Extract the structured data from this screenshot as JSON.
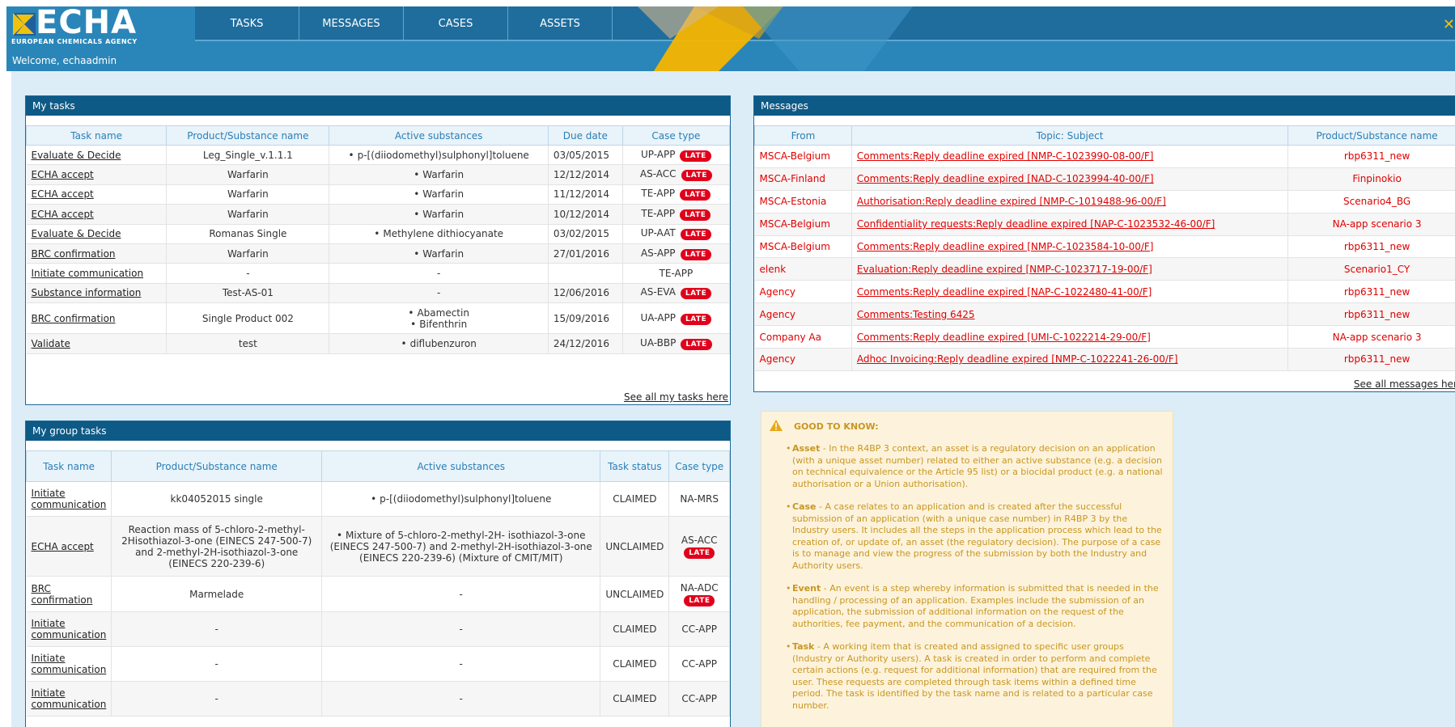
{
  "header": {
    "logo_text": "ECHA",
    "logo_sub": "EUROPEAN CHEMICALS AGENCY",
    "welcome": "Welcome, echaadmin",
    "nav": [
      "TASKS",
      "MESSAGES",
      "CASES",
      "ASSETS"
    ],
    "close_glyph": "✕"
  },
  "my_tasks": {
    "title": "My tasks",
    "columns": [
      "Task name",
      "Product/Substance name",
      "Active substances",
      "Due date",
      "Case type"
    ],
    "rows": [
      {
        "task": "Evaluate & Decide",
        "product": "Leg_Single_v.1.1.1",
        "active": [
          "p-[(diiodomethyl)sulphonyl]toluene"
        ],
        "due": "03/05/2015",
        "case": "UP-APP",
        "late": "LATE"
      },
      {
        "task": "ECHA accept",
        "product": "Warfarin",
        "active": [
          "Warfarin"
        ],
        "due": "12/12/2014",
        "case": "AS-ACC",
        "late": "LATE"
      },
      {
        "task": "ECHA accept",
        "product": "Warfarin",
        "active": [
          "Warfarin"
        ],
        "due": "11/12/2014",
        "case": "TE-APP",
        "late": "LATE"
      },
      {
        "task": "ECHA accept",
        "product": "Warfarin",
        "active": [
          "Warfarin"
        ],
        "due": "10/12/2014",
        "case": "TE-APP",
        "late": "LATE"
      },
      {
        "task": "Evaluate & Decide",
        "product": "Romanas Single",
        "active": [
          "Methylene dithiocyanate"
        ],
        "due": "03/02/2015",
        "case": "UP-AAT",
        "late": "LATE"
      },
      {
        "task": "BRC confirmation",
        "product": "Warfarin",
        "active": [
          "Warfarin"
        ],
        "due": "27/01/2016",
        "case": "AS-APP",
        "late": "LATE"
      },
      {
        "task": "Initiate communication",
        "product": "-",
        "active_text": "-",
        "due": "",
        "case": "TE-APP",
        "late": ""
      },
      {
        "task": "Substance information",
        "product": "Test-AS-01",
        "active_text": "-",
        "due": "12/06/2016",
        "case": "AS-EVA",
        "late": "LATE"
      },
      {
        "task": "BRC confirmation",
        "product": "Single Product 002",
        "active": [
          "Abamectin",
          "Bifenthrin"
        ],
        "due": "15/09/2016",
        "case": "UA-APP",
        "late": "LATE"
      },
      {
        "task": "Validate",
        "product": "test",
        "active": [
          "diflubenzuron"
        ],
        "due": "24/12/2016",
        "case": "UA-BBP",
        "late": "LATE"
      }
    ],
    "see_all": "See all my tasks here"
  },
  "group_tasks": {
    "title": "My group tasks",
    "columns": [
      "Task name",
      "Product/Substance name",
      "Active substances",
      "Task status",
      "Case type"
    ],
    "rows": [
      {
        "task": "Initiate communication",
        "product": "kk04052015 single",
        "active": "p-[(diiodomethyl)sulphonyl]toluene",
        "bullet": true,
        "status": "CLAIMED",
        "case": "NA-MRS",
        "late": ""
      },
      {
        "task": "ECHA accept",
        "product": "Reaction mass of 5-chloro-2-methyl-2Hisothiazol-3-one (EINECS 247-500-7) and 2-methyl-2H-isothiazol-3-one (EINECS 220-239-6)",
        "active": "Mixture of 5-chloro-2-methyl-2H- isothiazol-3-one (EINECS 247-500-7) and 2-methyl-2H-isothiazol-3-one (EINECS 220-239-6) (Mixture of CMIT/MIT)",
        "bullet": true,
        "status": "UNCLAIMED",
        "case": "AS-ACC",
        "late": "LATE"
      },
      {
        "task": "BRC confirmation",
        "product": "Marmelade",
        "active": "-",
        "bullet": false,
        "status": "UNCLAIMED",
        "case": "NA-ADC",
        "late": "LATE"
      },
      {
        "task": "Initiate communication",
        "product": "-",
        "active": "-",
        "bullet": false,
        "status": "CLAIMED",
        "case": "CC-APP",
        "late": ""
      },
      {
        "task": "Initiate communication",
        "product": "-",
        "active": "-",
        "bullet": false,
        "status": "CLAIMED",
        "case": "CC-APP",
        "late": ""
      },
      {
        "task": "Initiate communication",
        "product": "-",
        "active": "-",
        "bullet": false,
        "status": "CLAIMED",
        "case": "CC-APP",
        "late": ""
      }
    ]
  },
  "messages": {
    "title": "Messages",
    "columns": [
      "From",
      "Topic: Subject",
      "Product/Substance name"
    ],
    "rows": [
      {
        "from": "MSCA-Belgium",
        "subject": "Comments:Reply deadline expired [NMP-C-1023990-08-00/F]",
        "product": "rbp6311_new"
      },
      {
        "from": "MSCA-Finland",
        "subject": "Comments:Reply deadline expired [NAD-C-1023994-40-00/F]",
        "product": "Finpinokio"
      },
      {
        "from": "MSCA-Estonia",
        "subject": "Authorisation:Reply deadline expired [NMP-C-1019488-96-00/F]",
        "product": "Scenario4_BG"
      },
      {
        "from": "MSCA-Belgium",
        "subject": "Confidentiality requests:Reply deadline expired [NAP-C-1023532-46-00/F]",
        "product": "NA-app scenario 3"
      },
      {
        "from": "MSCA-Belgium",
        "subject": "Comments:Reply deadline expired [NMP-C-1023584-10-00/F]",
        "product": "rbp6311_new"
      },
      {
        "from": "elenk",
        "subject": "Evaluation:Reply deadline expired [NMP-C-1023717-19-00/F]",
        "product": "Scenario1_CY"
      },
      {
        "from": "Agency",
        "subject": "Comments:Reply deadline expired [NAP-C-1022480-41-00/F]",
        "product": "rbp6311_new"
      },
      {
        "from": "Agency",
        "subject": "Comments:Testing 6425",
        "product": "rbp6311_new"
      },
      {
        "from": "Company Aa",
        "subject": "Comments:Reply deadline expired [UMI-C-1022214-29-00/F]",
        "product": "NA-app scenario 3"
      },
      {
        "from": "Agency",
        "subject": "Adhoc Invoicing:Reply deadline expired [NMP-C-1022241-26-00/F]",
        "product": "rbp6311_new"
      }
    ],
    "see_all": "See all messages here"
  },
  "good_to_know": {
    "title": "GOOD TO KNOW:",
    "items": [
      {
        "term": "Asset",
        "text": " - In the R4BP 3 context, an asset is a regulatory decision on an application (with a unique asset number) related to either an active substance (e.g. a decision on technical equivalence or the Article 95 list) or a biocidal product (e.g. a national authorisation or a Union authorisation)."
      },
      {
        "term": "Case",
        "text": " - A case relates to an application and is created after the successful submission of an application (with a unique case number) in R4BP 3 by the Industry users. It includes all the steps in the application process which lead to the creation of, or update of, an asset (the regulatory decision). The purpose of a case is to manage and view the progress of the submission by both the Industry and Authority users."
      },
      {
        "term": "Event",
        "text": " - An event is a step whereby information is submitted that is needed in the handling / processing of an application. Examples include the submission of an application, the submission of additional information on the request of the authorities, fee payment, and the communication of a decision."
      },
      {
        "term": "Task",
        "text": " - A working item that is created and assigned to specific user groups (Industry or Authority users). A task is created in order to perform and complete certain actions (e.g. request for additional information) that are required from the user. These requests are completed through task items within a defined time period. The task is identified by the task name and is related to a particular case number."
      }
    ]
  },
  "colors": {
    "header": "#2a86b8",
    "nav": "#1f6d9d",
    "panel_title": "#0e5a86",
    "late": "#e1001b",
    "message_red": "#e00000",
    "logo_yellow": "#f0c20e"
  },
  "icons": {
    "warning": "warning-icon",
    "close": "close-icon",
    "logo": "echa-flag-logo"
  }
}
